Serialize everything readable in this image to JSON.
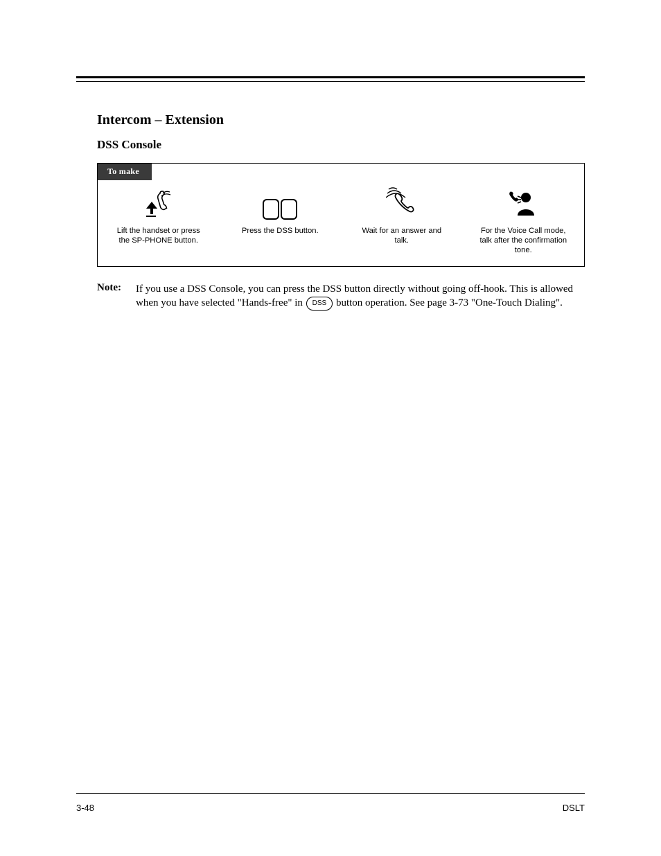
{
  "feature": {
    "title": "Intercom – Extension",
    "subtitle": "DSS Console",
    "boxLabel": "To make"
  },
  "steps": [
    {
      "label": "Lift the handset or press the SP-PHONE button."
    },
    {
      "label": "Press the DSS button."
    },
    {
      "label": "Wait for an answer and talk."
    },
    {
      "label": "For the Voice Call mode, talk after the confirmation tone."
    }
  ],
  "note": {
    "label": "Note:",
    "text_pre": "If you use a DSS Console, you can press the DSS button directly without going off-hook. This is allowed when you have selected \"Hands-free\" in ",
    "key_label": "DSS",
    "text_mid": " button operation. See page 3-73 ",
    "link": "\"One-Touch Dialing\"",
    "text_post": "."
  },
  "footer": {
    "left": "3-48",
    "right": "DSLT"
  }
}
